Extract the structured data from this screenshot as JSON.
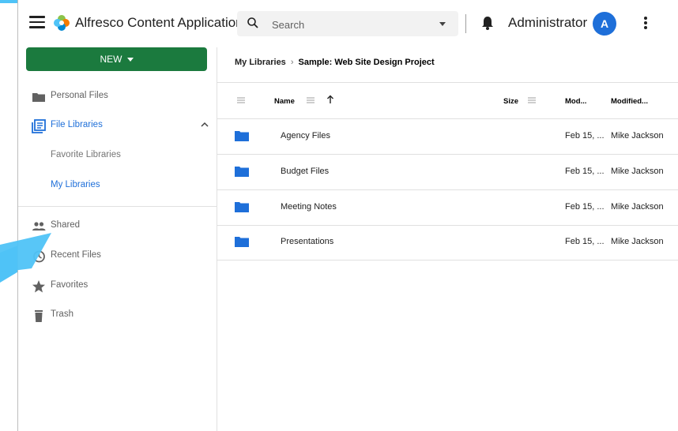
{
  "app": {
    "title": "Alfresco Content Application"
  },
  "search": {
    "placeholder": "Search"
  },
  "header": {
    "user_name": "Administrator",
    "avatar_initial": "A"
  },
  "sidebar": {
    "new_label": "NEW",
    "items": [
      {
        "label": "Personal Files",
        "icon": "folder-icon"
      },
      {
        "label": "File Libraries",
        "icon": "library-icon",
        "active": true
      },
      {
        "label": "Favorite Libraries"
      },
      {
        "label": "My Libraries",
        "selected": true
      },
      {
        "label": "Shared",
        "icon": "people-icon"
      },
      {
        "label": "Recent Files",
        "icon": "history-icon"
      },
      {
        "label": "Favorites",
        "icon": "star-icon"
      },
      {
        "label": "Trash",
        "icon": "trash-icon"
      }
    ]
  },
  "breadcrumb": {
    "parent": "My Libraries",
    "separator": "›",
    "current": "Sample: Web Site Design Project"
  },
  "table": {
    "columns": {
      "name": "Name",
      "size": "Size",
      "modified": "Mod...",
      "modified_by": "Modified..."
    },
    "rows": [
      {
        "name": "Agency Files",
        "modified": "Feb 15, ...",
        "modified_by": "Mike Jackson"
      },
      {
        "name": "Budget Files",
        "modified": "Feb 15, ...",
        "modified_by": "Mike Jackson"
      },
      {
        "name": "Meeting Notes",
        "modified": "Feb 15, ...",
        "modified_by": "Mike Jackson"
      },
      {
        "name": "Presentations",
        "modified": "Feb 15, ...",
        "modified_by": "Mike Jackson"
      }
    ]
  },
  "colors": {
    "accent_blue": "#1e6fd9",
    "new_button": "#1b7a3e",
    "folder": "#1e6fd9"
  }
}
